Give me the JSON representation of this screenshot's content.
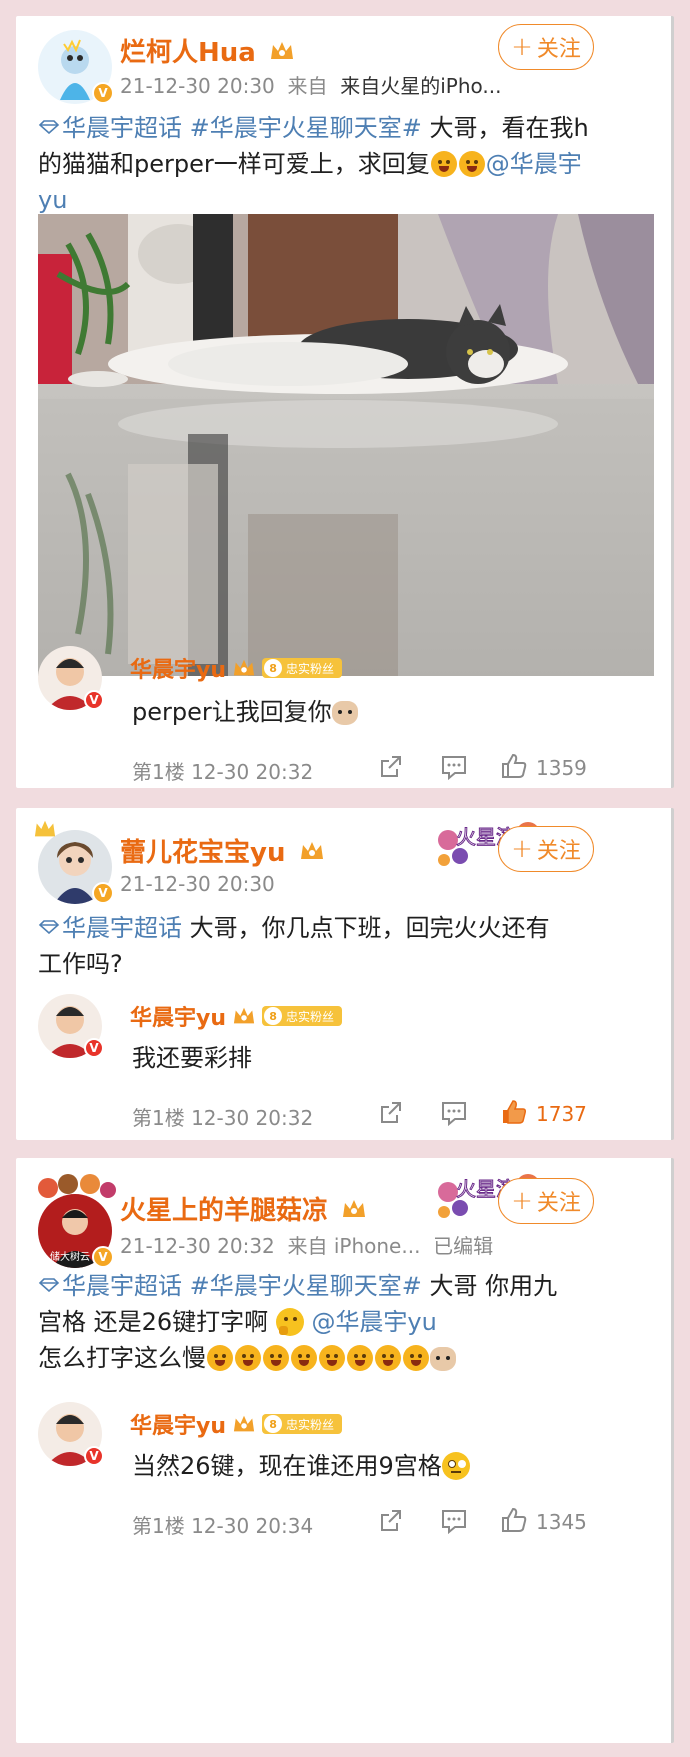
{
  "posts": [
    {
      "username": "烂柯人Hua",
      "meta_time": "21-12-30 20:30",
      "meta_from": "来自",
      "meta_device": "来自火星的iPho...",
      "follow_label": "关注",
      "text_topic1": "华晨宇超话",
      "text_topic2": "#华晨宇火星聊天室#",
      "text_line1_rest": " 大哥，看在我h",
      "text_line2": "的猫猫和perper一样可爱上，求回复",
      "text_mention": "@华晨宇",
      "text_line3": "yu",
      "reply": {
        "name": "华晨宇yu",
        "fan_level": "8",
        "fan_label": "忠实粉丝",
        "text": "perper让我回复你",
        "floor": "第1楼 12-30 20:32",
        "likes": "1359"
      }
    },
    {
      "username": "蕾儿花宝宝yu",
      "meta_time": "21-12-30 20:30",
      "follow_label": "关注",
      "banner_text": "火星演唱",
      "text_topic1": "华晨宇超话",
      "text_line1_rest": "  大哥，你几点下班，回完火火还有",
      "text_line2": "工作吗?",
      "reply": {
        "name": "华晨宇yu",
        "fan_level": "8",
        "fan_label": "忠实粉丝",
        "text": "我还要彩排",
        "floor": "第1楼 12-30 20:32",
        "likes": "1737"
      }
    },
    {
      "username": "火星上的羊腿菇凉",
      "meta_time": "21-12-30 20:32",
      "meta_from": "来自 iPhone...",
      "meta_edited": "已编辑",
      "follow_label": "关注",
      "banner_text": "火星演唱",
      "avatar_text": "储大树云",
      "text_topic1": "华晨宇超话",
      "text_topic2": "#华晨宇火星聊天室#",
      "text_line1_rest": "  大哥 你用九",
      "text_line2": "宫格 还是26键打字啊 ",
      "text_mention": "@华晨宇yu",
      "text_line3": "怎么打字这么慢",
      "reply": {
        "name": "华晨宇yu",
        "fan_level": "8",
        "fan_label": "忠实粉丝",
        "text": "当然26键，现在谁还用9宫格",
        "floor": "第1楼 12-30 20:34",
        "likes": "1345"
      }
    }
  ],
  "colors": {
    "background": "#f1dcdf",
    "username": "#e96a12",
    "topic_link": "#4e7fb3",
    "follow_border": "#f08a2a",
    "muted": "#8a8a8a"
  }
}
